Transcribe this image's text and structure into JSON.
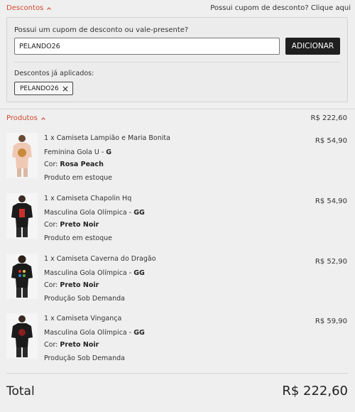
{
  "discounts": {
    "toggle_label": "Descontos",
    "hint": "Possui cupom de desconto? Clique aqui",
    "prompt": "Possui um cupom de desconto ou vale-presente?",
    "input_value": "PELANDO26",
    "add_label": "ADICIONAR",
    "applied_label": "Descontos já aplicados:",
    "applied_code": "PELANDO26",
    "remove_glyph": "×"
  },
  "products": {
    "toggle_label": "Produtos",
    "subtotal": "R$ 222,60",
    "items": [
      {
        "title": "1 x Camiseta Lampião e Maria Bonita",
        "fit_prefix": "Feminina Gola U - ",
        "size": "G",
        "color_prefix": "Cor: ",
        "color": "Rosa Peach",
        "availability": "Produto em estoque",
        "price": "R$ 54,90"
      },
      {
        "title": "1 x Camiseta Chapolin Hq",
        "fit_prefix": "Masculina Gola Olímpica - ",
        "size": "GG",
        "color_prefix": "Cor: ",
        "color": "Preto Noir",
        "availability": "Produto em estoque",
        "price": "R$ 54,90"
      },
      {
        "title": "1 x Camiseta Caverna do Dragão",
        "fit_prefix": "Masculina Gola Olímpica - ",
        "size": "GG",
        "color_prefix": "Cor: ",
        "color": "Preto Noir",
        "availability": "Produção Sob Demanda",
        "price": "R$ 52,90"
      },
      {
        "title": "1 x Camiseta Vingança",
        "fit_prefix": "Masculina Gola Olímpica - ",
        "size": "GG",
        "color_prefix": "Cor: ",
        "color": "Preto Noir",
        "availability": "Produção Sob Demanda",
        "price": "R$ 59,90"
      }
    ]
  },
  "total": {
    "label": "Total",
    "value": "R$ 222,60"
  },
  "colors": {
    "accent": "#d14b2e",
    "button_bg": "#1f1f1f",
    "background": "#efefef"
  },
  "icons": {
    "section_toggle": "chevron-up-icon",
    "chip_remove": "close-icon"
  }
}
